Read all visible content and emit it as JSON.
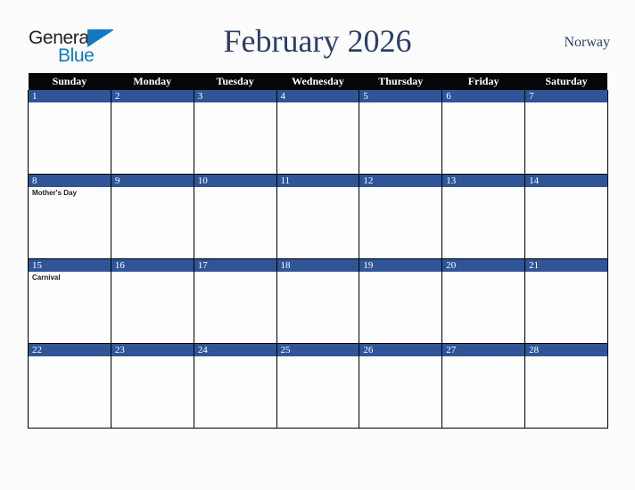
{
  "brand": {
    "name_part1": "General",
    "name_part2": "Blue",
    "triangle_color": "#1179bf",
    "text_color": "#231f20"
  },
  "header": {
    "title": "February 2026",
    "country": "Norway",
    "title_color": "#2b3f67"
  },
  "colors": {
    "weekday_header_bg": "#050608",
    "weekday_header_text": "#ffffff",
    "date_band_bg": "#2f5597",
    "date_band_text": "#ffffff",
    "cell_bg": "#fdfdfd",
    "grid_line": "#000000",
    "page_bg": "#fcfcfd"
  },
  "calendar": {
    "weekdays": [
      "Sunday",
      "Monday",
      "Tuesday",
      "Wednesday",
      "Thursday",
      "Friday",
      "Saturday"
    ],
    "weeks": [
      [
        {
          "day": "1",
          "events": []
        },
        {
          "day": "2",
          "events": []
        },
        {
          "day": "3",
          "events": []
        },
        {
          "day": "4",
          "events": []
        },
        {
          "day": "5",
          "events": []
        },
        {
          "day": "6",
          "events": []
        },
        {
          "day": "7",
          "events": []
        }
      ],
      [
        {
          "day": "8",
          "events": [
            "Mother's Day"
          ]
        },
        {
          "day": "9",
          "events": []
        },
        {
          "day": "10",
          "events": []
        },
        {
          "day": "11",
          "events": []
        },
        {
          "day": "12",
          "events": []
        },
        {
          "day": "13",
          "events": []
        },
        {
          "day": "14",
          "events": []
        }
      ],
      [
        {
          "day": "15",
          "events": [
            "Carnival"
          ]
        },
        {
          "day": "16",
          "events": []
        },
        {
          "day": "17",
          "events": []
        },
        {
          "day": "18",
          "events": []
        },
        {
          "day": "19",
          "events": []
        },
        {
          "day": "20",
          "events": []
        },
        {
          "day": "21",
          "events": []
        }
      ],
      [
        {
          "day": "22",
          "events": []
        },
        {
          "day": "23",
          "events": []
        },
        {
          "day": "24",
          "events": []
        },
        {
          "day": "25",
          "events": []
        },
        {
          "day": "26",
          "events": []
        },
        {
          "day": "27",
          "events": []
        },
        {
          "day": "28",
          "events": []
        }
      ]
    ]
  }
}
